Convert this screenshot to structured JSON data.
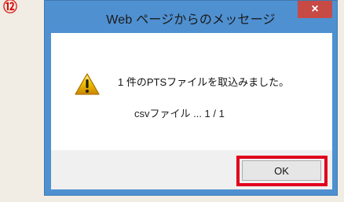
{
  "step": {
    "number": "⑫"
  },
  "dialog": {
    "title": "Web ページからのメッセージ",
    "close_label": "×",
    "icon": "warning-icon",
    "message": "1 件のPTSファイルを取込みました。",
    "detail": "csvファイル ... 1 / 1",
    "ok_label": "OK"
  },
  "colors": {
    "page_background": "#f1ece4",
    "title_bar": "#4f90d1",
    "close_button": "#c84a45",
    "highlight_border": "#e0001b",
    "warning_yellow": "#f2c200"
  }
}
